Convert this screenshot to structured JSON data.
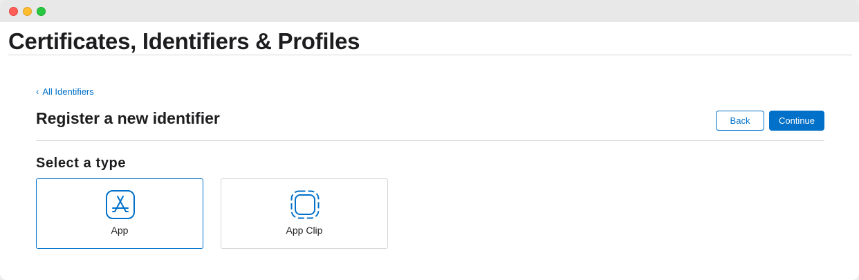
{
  "window": {
    "controls": [
      "close",
      "minimize",
      "zoom"
    ]
  },
  "header": {
    "title": "Certificates, Identifiers & Profiles"
  },
  "breadcrumb": {
    "chevron": "‹",
    "label": "All Identifiers"
  },
  "section": {
    "title": "Register a new identifier",
    "back_label": "Back",
    "continue_label": "Continue"
  },
  "type_select": {
    "heading": "Select a type",
    "options": [
      {
        "label": "App",
        "icon": "app-store-icon",
        "selected": true
      },
      {
        "label": "App Clip",
        "icon": "app-clip-icon",
        "selected": false
      }
    ]
  },
  "colors": {
    "accent": "#0070c9",
    "divider": "#d6d6d6",
    "text": "#1d1d1f"
  }
}
